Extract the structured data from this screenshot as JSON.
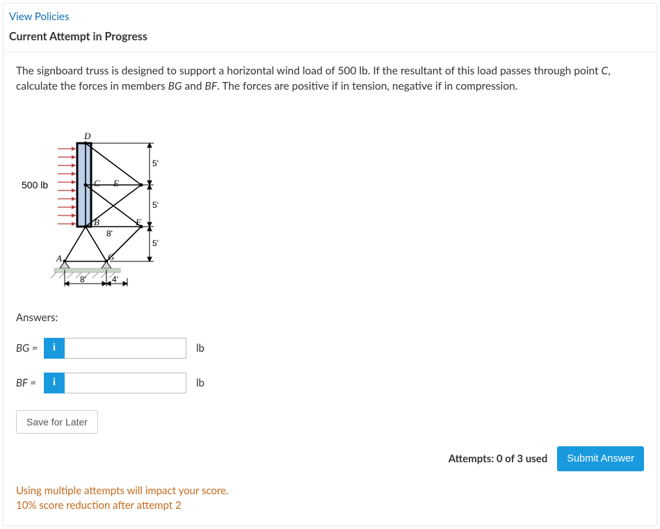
{
  "links": {
    "view_policies": "View Policies"
  },
  "header": {
    "attempt_title": "Current Attempt in Progress"
  },
  "question": {
    "prompt_html": "The signboard truss is designed to support a horizontal wind load of 500 lb. If the resultant of this load passes through point C, calculate the forces in members BG and BF. The forces are positive if in tension, negative if in compression."
  },
  "figure": {
    "load_label": "500 lb",
    "points": {
      "A": "A",
      "B": "B",
      "C": "C",
      "D": "D",
      "E": "E",
      "F": "F",
      "G": "G"
    },
    "dims": {
      "d5a": "5'",
      "d5b": "5'",
      "d5c": "5'",
      "d8v": "8'",
      "d8h": "8'",
      "d4h": "4'"
    }
  },
  "answers": {
    "section_label": "Answers:",
    "rows": [
      {
        "var": "BG",
        "value": "",
        "unit": "lb"
      },
      {
        "var": "BF",
        "value": "",
        "unit": "lb"
      }
    ],
    "info_glyph": "i"
  },
  "actions": {
    "save": "Save for Later",
    "submit": "Submit Answer"
  },
  "footer": {
    "attempts": "Attempts: 0 of 3 used",
    "note1": "Using multiple attempts will impact your score.",
    "note2": "10% score reduction after attempt 2"
  }
}
